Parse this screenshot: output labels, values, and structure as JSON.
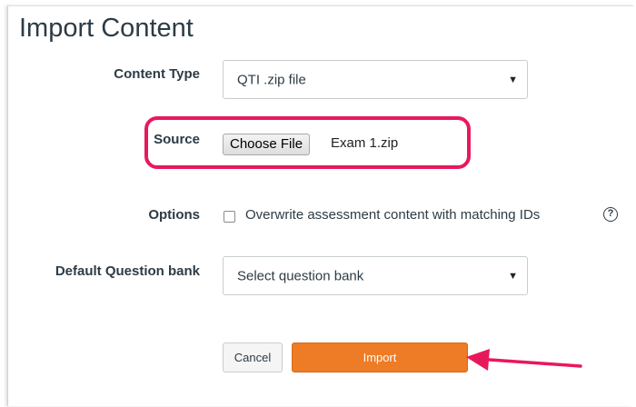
{
  "page": {
    "title": "Import Content"
  },
  "form": {
    "content_type": {
      "label": "Content Type",
      "selected": "QTI .zip file"
    },
    "source": {
      "label": "Source",
      "choose_button": "Choose File",
      "file_name": "Exam 1.zip"
    },
    "options": {
      "label": "Options",
      "checkbox_label": "Overwrite assessment content with matching IDs",
      "checked": false,
      "help_icon": "?"
    },
    "question_bank": {
      "label": "Default Question bank",
      "selected": "Select question bank"
    }
  },
  "actions": {
    "cancel_label": "Cancel",
    "import_label": "Import"
  },
  "colors": {
    "accent_import": "#ee7b25",
    "highlight": "#e8195b",
    "text": "#2d3b45"
  },
  "icons": {
    "dropdown": "chevron-down-icon",
    "help": "question-circle-icon",
    "annotation": "arrow-left-icon"
  }
}
